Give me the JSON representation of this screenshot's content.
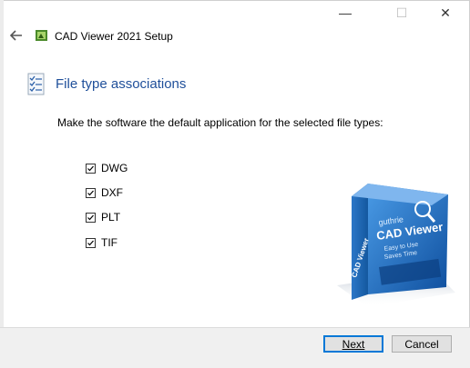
{
  "window": {
    "title": "CAD Viewer 2021 Setup",
    "controls": {
      "minimize": "—",
      "maximize": "☐",
      "close": "✕"
    }
  },
  "header": {
    "icon": "checklist-icon",
    "heading": "File type associations"
  },
  "content": {
    "instruction": "Make the software the default application for the selected file types:",
    "file_types": [
      {
        "label": "DWG",
        "checked": true
      },
      {
        "label": "DXF",
        "checked": true
      },
      {
        "label": "PLT",
        "checked": true
      },
      {
        "label": "TIF",
        "checked": true
      }
    ]
  },
  "product_box": {
    "brand": "guthrie",
    "name": "CAD Viewer",
    "tagline_1": "Easy to Use",
    "tagline_2": "Saves Time",
    "side_text": "CAD Viewer"
  },
  "footer": {
    "next_label": "Next",
    "cancel_label": "Cancel"
  },
  "colors": {
    "heading": "#1f4f9a",
    "accent": "#0078d7",
    "box_blue": "#1d6fc4"
  }
}
